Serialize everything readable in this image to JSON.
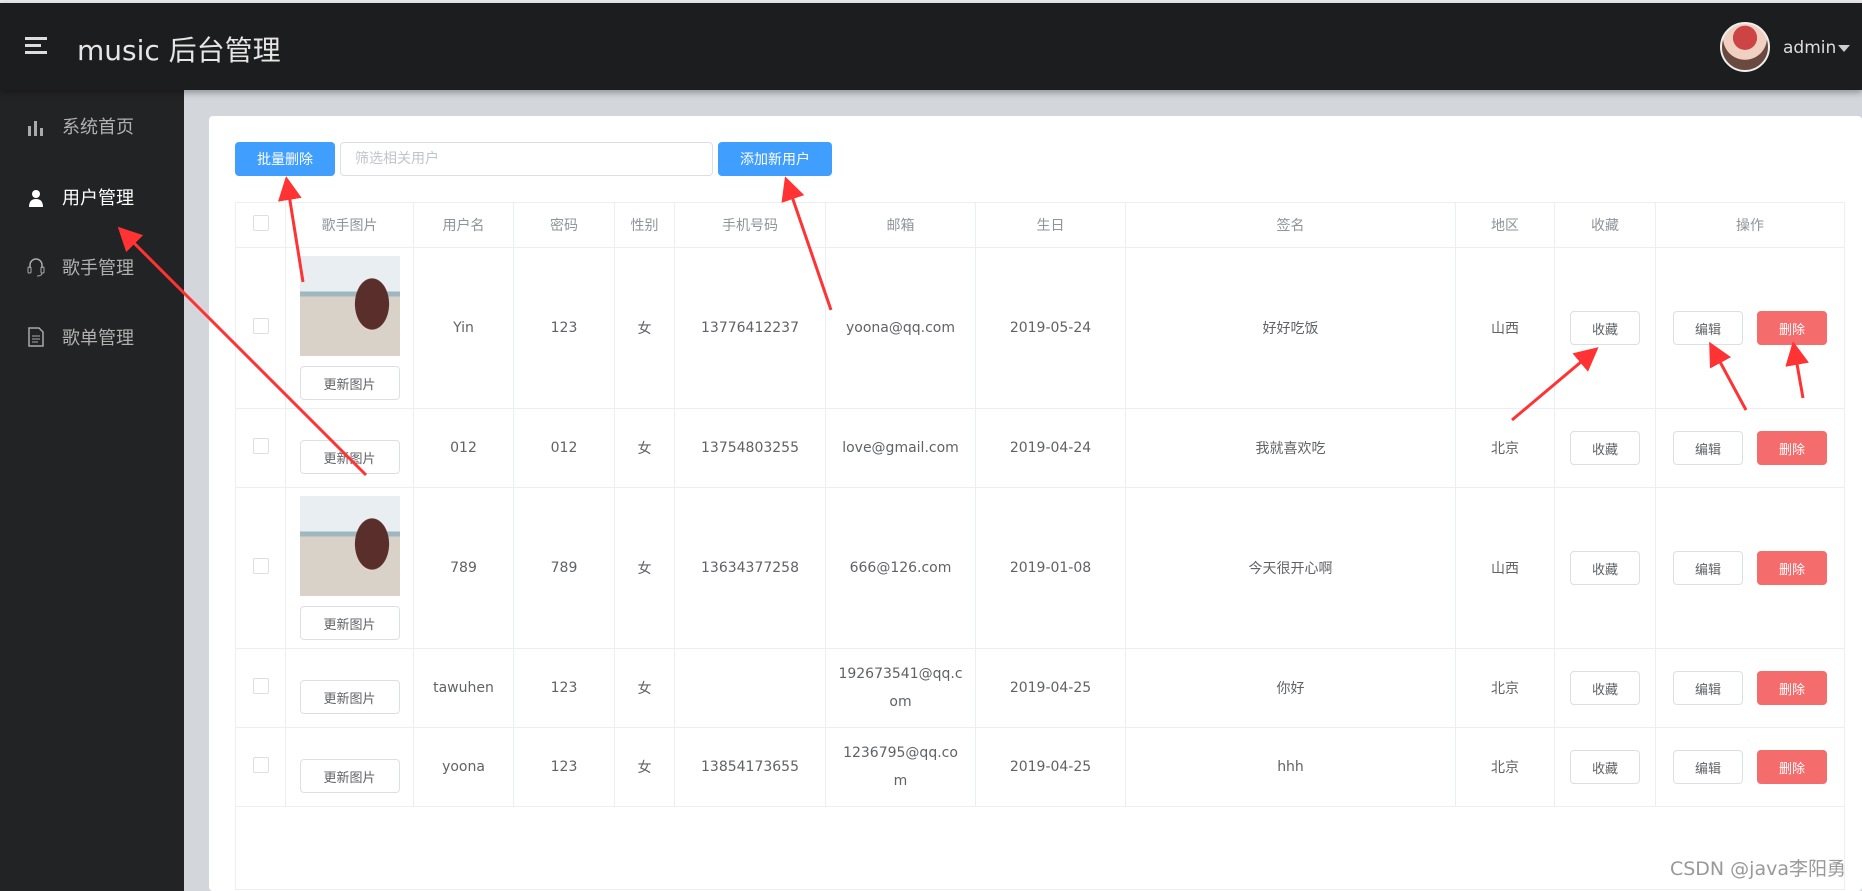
{
  "header": {
    "title": "music 后台管理",
    "user": "admin"
  },
  "sidebar": {
    "items": [
      {
        "label": "系统首页",
        "icon": "bar-chart-icon"
      },
      {
        "label": "用户管理",
        "icon": "user-icon"
      },
      {
        "label": "歌手管理",
        "icon": "headset-icon"
      },
      {
        "label": "歌单管理",
        "icon": "document-icon"
      }
    ]
  },
  "toolbar": {
    "batch_delete": "批量删除",
    "search_placeholder": "筛选相关用户",
    "search_value": "",
    "add_user": "添加新用户"
  },
  "table": {
    "headers": [
      "歌手图片",
      "用户名",
      "密码",
      "性别",
      "手机号码",
      "邮箱",
      "生日",
      "签名",
      "地区",
      "收藏",
      "操作"
    ],
    "update_image": "更新图片",
    "collect": "收藏",
    "edit": "编辑",
    "delete": "删除",
    "rows": [
      {
        "has_photo": true,
        "username": "Yin",
        "password": "123",
        "sex": "女",
        "phone": "13776412237",
        "email": "yoona@qq.com",
        "birth": "2019-05-24",
        "intro": "好好吃饭",
        "location": "山西"
      },
      {
        "has_photo": false,
        "username": "012",
        "password": "012",
        "sex": "女",
        "phone": "13754803255",
        "email": "love@gmail.com",
        "birth": "2019-04-24",
        "intro": "我就喜欢吃",
        "location": "北京"
      },
      {
        "has_photo": true,
        "username": "789",
        "password": "789",
        "sex": "女",
        "phone": "13634377258",
        "email": "666@126.com",
        "birth": "2019-01-08",
        "intro": "今天很开心啊",
        "location": "山西"
      },
      {
        "has_photo": false,
        "username": "tawuhen",
        "password": "123",
        "sex": "女",
        "phone": "",
        "email": "192673541@qq.com",
        "birth": "2019-04-25",
        "intro": "你好",
        "location": "北京"
      },
      {
        "has_photo": false,
        "username": "yoona",
        "password": "123",
        "sex": "女",
        "phone": "13854173655",
        "email": "1236795@qq.com",
        "birth": "2019-04-25",
        "intro": "hhh",
        "location": "北京"
      }
    ]
  },
  "colors": {
    "primary": "#409eff",
    "danger": "#f56c6c",
    "header_bg": "#1c1d1f",
    "sidebar_bg": "#222325",
    "annotation": "#ff3333"
  },
  "watermark": "CSDN @java李阳勇"
}
